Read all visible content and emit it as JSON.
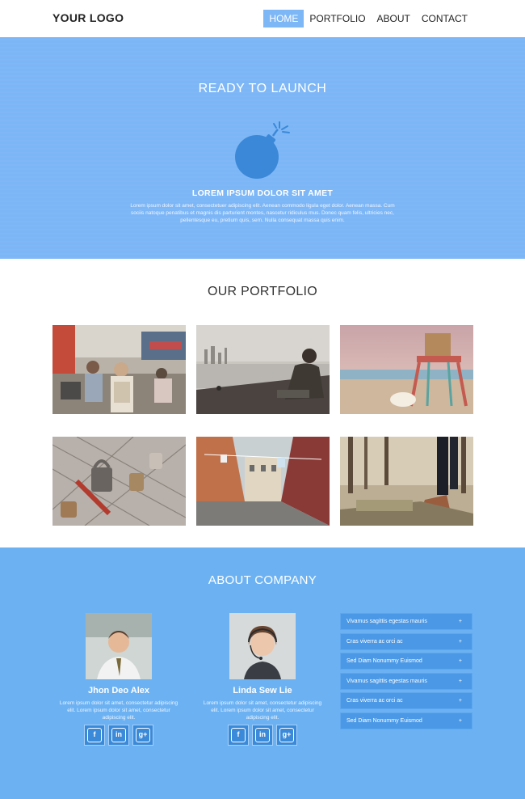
{
  "header": {
    "logo": "YOUR LOGO",
    "nav": [
      {
        "label": "HOME",
        "active": true
      },
      {
        "label": "PORTFOLIO",
        "active": false
      },
      {
        "label": "ABOUT",
        "active": false
      },
      {
        "label": "CONTACT",
        "active": false
      }
    ]
  },
  "hero": {
    "title": "READY TO LAUNCH",
    "icon": "bomb-icon",
    "subtitle": "LOREM IPSUM DOLOR SIT AMET",
    "text": "Lorem ipsum dolor sit amet, consectetuer adipiscing elit. Aenean commodo ligula eget dolor. Aenean massa. Cum sociis natoque penatibus et magnis dis parturient montes, nascetur ridiculus mus. Donec quam felis, ultricies nec, pellentesque eu, pretium quis, sem. Nulla consequat massa quis enim."
  },
  "portfolio": {
    "title": "OUR PORTFOLIO"
  },
  "about": {
    "title": "ABOUT COMPANY",
    "members": [
      {
        "name": "Jhon Deo Alex",
        "bio": "Lorem ipsum dolor sit amet, consectetur adipiscing elit. Lorem ipsum dolor sit amet, consectetur adipiscing elit."
      },
      {
        "name": "Linda Sew Lie",
        "bio": "Lorem ipsum dolor sit amet, consectetur adipiscing elit. Lorem ipsum dolor sit amet, consectetur adipiscing elit."
      }
    ],
    "social_icons": [
      "facebook-icon",
      "linkedin-icon",
      "google-plus-icon"
    ],
    "accordion": [
      "Vivamus sagittis egestas mauris",
      "Cras viverra ac orci ac",
      "Sed Diam Nonummy Euismod",
      "Vivamus sagittis egestas mauris",
      "Cras viverra ac orci ac",
      "Sed Diam Nonummy Euismod"
    ]
  },
  "colors": {
    "accent": "#7db7f5",
    "hero_bg": "#7cb6f6",
    "about_bg": "#6cb2f3",
    "accordion_bg": "#4a98e6",
    "social_bg": "#3b8ad9",
    "bomb": "#3b88d8"
  }
}
